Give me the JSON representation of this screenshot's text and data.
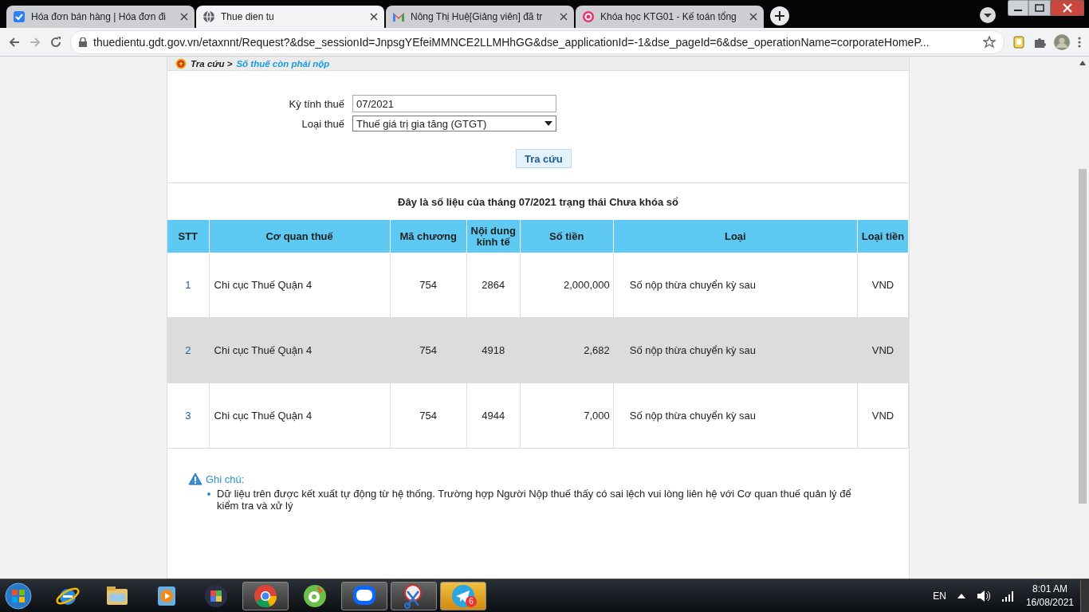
{
  "browser": {
    "tabs": [
      {
        "title": "Hóa đơn bán hàng | Hóa đơn đi",
        "selected": false
      },
      {
        "title": "Thue dien tu",
        "selected": true
      },
      {
        "title": "Nông Thị Huệ[Giảng viên] đã tr",
        "selected": false
      },
      {
        "title": "Khóa học KTG01 - Kế toán tổng",
        "selected": false
      }
    ],
    "url": "thuedientu.gdt.gov.vn/etaxnnt/Request?&dse_sessionId=JnpsgYEfeiMMNCE2LLMHhGG&dse_applicationId=-1&dse_pageId=6&dse_operationName=corporateHomeP..."
  },
  "page": {
    "breadcrumb": {
      "root": "Tra cứu >",
      "current": "Số thuế còn phải nộp"
    },
    "form": {
      "fields": [
        {
          "kind": "text",
          "label": "Kỳ tính thuế",
          "value": "07/2021"
        },
        {
          "kind": "select",
          "label": "Loại thuế",
          "value": "Thuế giá trị gia tăng (GTGT)"
        }
      ],
      "button": "Tra cứu"
    },
    "caption": "Đây là số liệu của tháng 07/2021 trạng thái Chưa khóa sổ",
    "table": {
      "columns": [
        "STT",
        "Cơ quan thuế",
        "Mã chương",
        "Nội dung kinh tế",
        "Số tiền",
        "Loại",
        "Loại tiền"
      ],
      "rows": [
        [
          "1",
          "Chi cục Thuế Quận 4",
          "754",
          "2864",
          "2,000,000",
          "Số nộp thừa chuyển kỳ sau",
          "VND"
        ],
        [
          "2",
          "Chi cục Thuế Quận 4",
          "754",
          "4918",
          "2,682",
          "Số nộp thừa chuyển kỳ sau",
          "VND"
        ],
        [
          "3",
          "Chi cục Thuế Quận 4",
          "754",
          "4944",
          "7,000",
          "Số nộp thừa chuyển kỳ sau",
          "VND"
        ]
      ]
    },
    "note": {
      "title": "Ghi chú:",
      "items": [
        "Dữ liệu trên được kết xuất tự động từ hệ thống. Trường hợp Người Nộp thuế thấy có sai lệch vui lòng liên hệ với Cơ quan thuế quản lý để kiểm tra và xử lý"
      ]
    }
  },
  "taskbar": {
    "apps": [
      {
        "running": false
      },
      {
        "running": false
      },
      {
        "running": false
      },
      {
        "running": false
      },
      {
        "running": true
      },
      {
        "running": false
      },
      {
        "running": true
      },
      {
        "running": true
      },
      {
        "running": true,
        "badge": "6"
      }
    ],
    "language": "EN",
    "time": "8:01 AM",
    "date": "16/08/2021"
  }
}
